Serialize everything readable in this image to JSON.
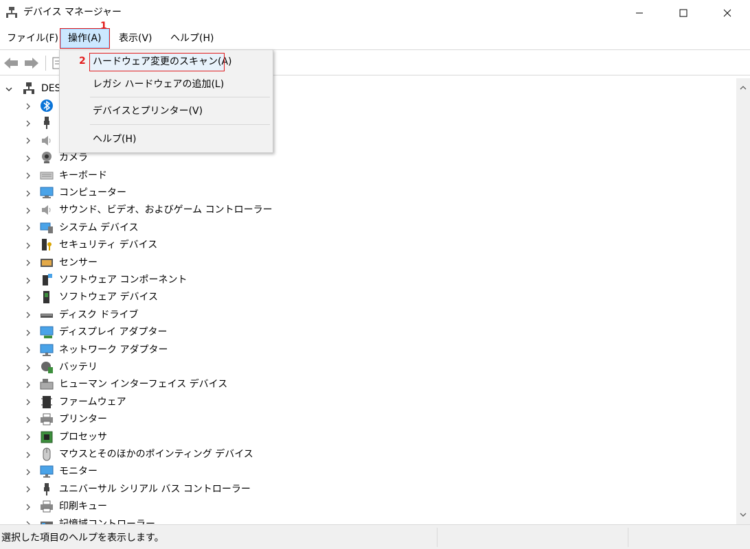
{
  "window": {
    "title": "デバイス マネージャー"
  },
  "menu": {
    "items": [
      {
        "label": "ファイル(F)"
      },
      {
        "label": "操作(A)"
      },
      {
        "label": "表示(V)"
      },
      {
        "label": "ヘルプ(H)"
      }
    ]
  },
  "annotations": {
    "step1": "1",
    "step2": "2"
  },
  "dropdown": {
    "items": [
      {
        "label": "ハードウェア変更のスキャン(A)"
      },
      {
        "label": "レガシ ハードウェアの追加(L)"
      },
      {
        "label": "デバイスとプリンター(V)"
      },
      {
        "label": "ヘルプ(H)"
      }
    ]
  },
  "tree": {
    "root_label": "DES",
    "items": [
      {
        "label": "",
        "icon": "bluetooth-icon"
      },
      {
        "label": "",
        "icon": "usb-plug-icon"
      },
      {
        "label": "",
        "icon": "speaker-icon"
      },
      {
        "label": "カメラ",
        "icon": "camera-icon"
      },
      {
        "label": "キーボード",
        "icon": "keyboard-icon"
      },
      {
        "label": "コンピューター",
        "icon": "computer-icon"
      },
      {
        "label": "サウンド、ビデオ、およびゲーム コントローラー",
        "icon": "speaker-icon"
      },
      {
        "label": "システム デバイス",
        "icon": "system-device-icon"
      },
      {
        "label": "セキュリティ デバイス",
        "icon": "security-key-icon"
      },
      {
        "label": "センサー",
        "icon": "sensor-icon"
      },
      {
        "label": "ソフトウェア コンポーネント",
        "icon": "software-component-icon"
      },
      {
        "label": "ソフトウェア デバイス",
        "icon": "software-device-icon"
      },
      {
        "label": "ディスク ドライブ",
        "icon": "disk-drive-icon"
      },
      {
        "label": "ディスプレイ アダプター",
        "icon": "display-adapter-icon"
      },
      {
        "label": "ネットワーク アダプター",
        "icon": "network-adapter-icon"
      },
      {
        "label": "バッテリ",
        "icon": "battery-icon"
      },
      {
        "label": "ヒューマン インターフェイス デバイス",
        "icon": "hid-icon"
      },
      {
        "label": "ファームウェア",
        "icon": "firmware-icon"
      },
      {
        "label": "プリンター",
        "icon": "printer-icon"
      },
      {
        "label": "プロセッサ",
        "icon": "processor-icon"
      },
      {
        "label": "マウスとそのほかのポインティング デバイス",
        "icon": "mouse-icon"
      },
      {
        "label": "モニター",
        "icon": "monitor-icon"
      },
      {
        "label": "ユニバーサル シリアル バス コントローラー",
        "icon": "usb-plug-icon"
      },
      {
        "label": "印刷キュー",
        "icon": "printer-icon"
      },
      {
        "label": "記憶域コントローラー",
        "icon": "storage-controller-icon"
      }
    ]
  },
  "status": {
    "text": "選択した項目のヘルプを表示します。"
  },
  "colors": {
    "annotation_red": "#e21b1b",
    "menu_highlight": "#cce8ff"
  }
}
